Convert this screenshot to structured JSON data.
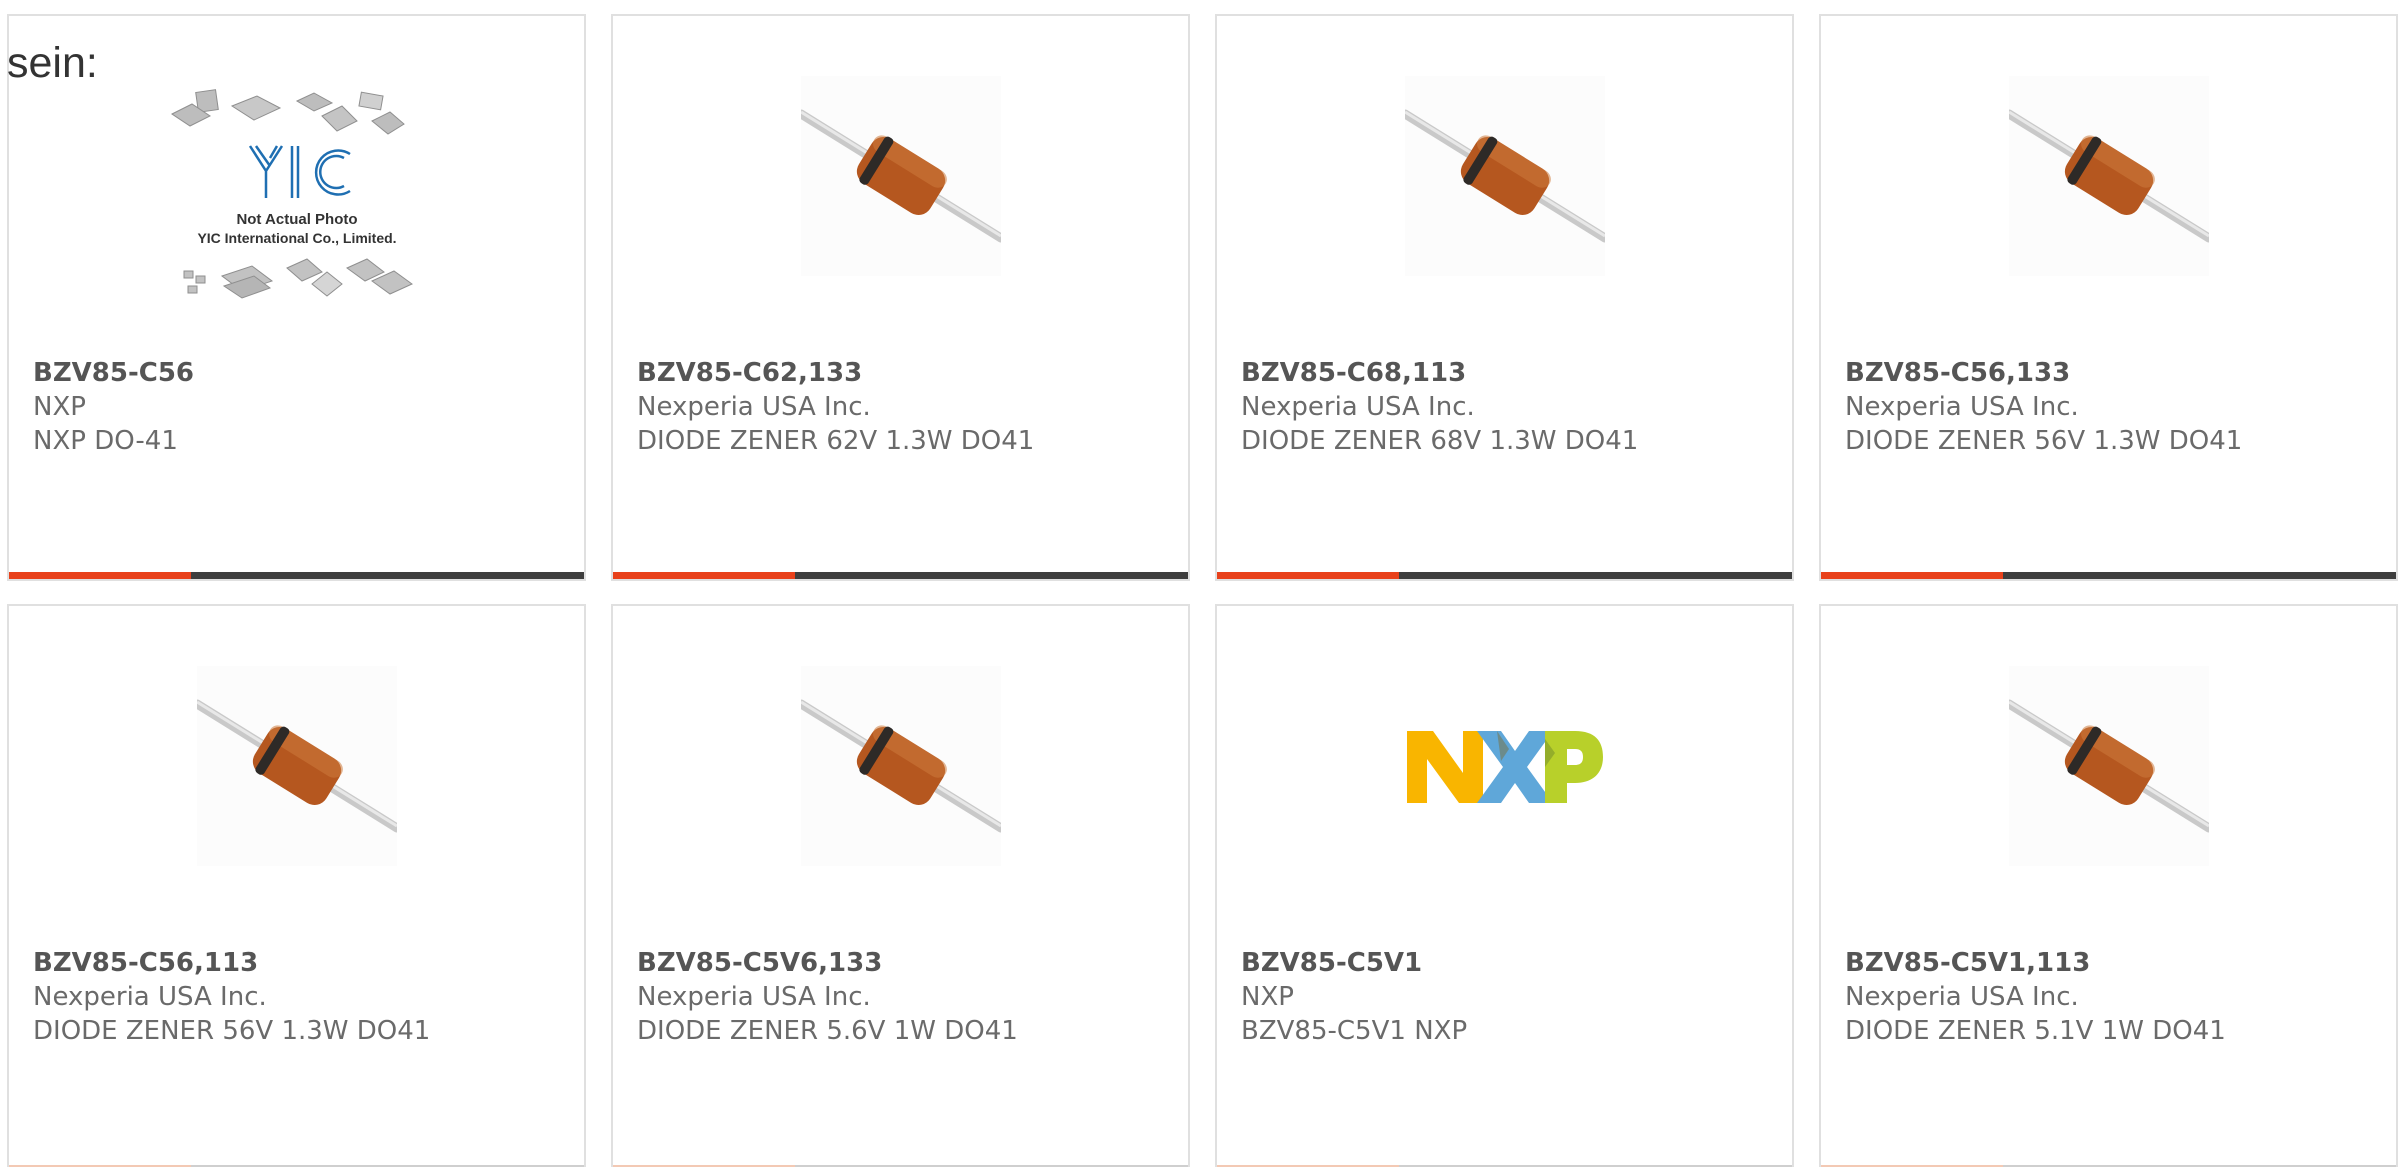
{
  "intro_text": "sein:",
  "colors": {
    "accent": "#e8411b",
    "bar_dark": "#3e3e3e",
    "card_border": "#e0e0e0",
    "text": "#6a6a6a",
    "diode_body": "#b5571f",
    "nxp_yellow": "#f9b500",
    "nxp_blue": "#5fa7d9",
    "nxp_green": "#b8d02a",
    "yic_blue": "#1f6fb2"
  },
  "products": [
    {
      "part_number": "BZV85-C56",
      "manufacturer": "NXP",
      "description": "NXP DO-41",
      "image": "generic-photo",
      "photo_caption_line1": "Not Actual Photo",
      "photo_caption_line2": "YIC International Co., Limited.",
      "logo_text": "YIC"
    },
    {
      "part_number": "BZV85-C62,133",
      "manufacturer": "Nexperia USA Inc.",
      "description": "DIODE ZENER 62V 1.3W DO41",
      "image": "diode-photo"
    },
    {
      "part_number": "BZV85-C68,113",
      "manufacturer": "Nexperia USA Inc.",
      "description": "DIODE ZENER 68V 1.3W DO41",
      "image": "diode-photo"
    },
    {
      "part_number": "BZV85-C56,133",
      "manufacturer": "Nexperia USA Inc.",
      "description": "DIODE ZENER 56V 1.3W DO41",
      "image": "diode-photo"
    },
    {
      "part_number": "BZV85-C56,113",
      "manufacturer": "Nexperia USA Inc.",
      "description": "DIODE ZENER 56V 1.3W DO41",
      "image": "diode-photo"
    },
    {
      "part_number": "BZV85-C5V6,133",
      "manufacturer": "Nexperia USA Inc.",
      "description": "DIODE ZENER 5.6V 1W DO41",
      "image": "diode-photo"
    },
    {
      "part_number": "BZV85-C5V1",
      "manufacturer": "NXP",
      "description": "BZV85-C5V1 NXP",
      "image": "nxp-logo"
    },
    {
      "part_number": "BZV85-C5V1,113",
      "manufacturer": "Nexperia USA Inc.",
      "description": "DIODE ZENER 5.1V 1W DO41",
      "image": "diode-photo"
    }
  ]
}
